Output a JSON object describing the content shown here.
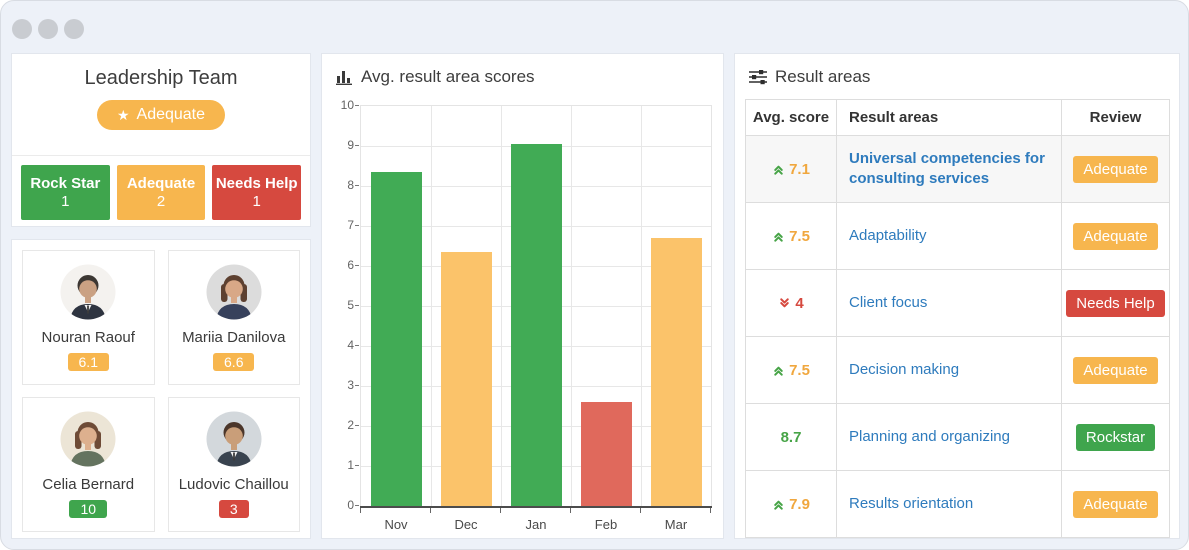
{
  "colors": {
    "green": "#3fa54d",
    "orange": "#f7b64e",
    "red": "#d6493f",
    "bar_green": "#41ab55",
    "bar_orange": "#fbc36a",
    "bar_red": "#e0695c",
    "score_orange": "#f0a73e",
    "score_green": "#47a447",
    "score_red": "#d6493f",
    "link_blue": "#2e7bbd"
  },
  "icons": {
    "chart_title_icon": "bar-chart-icon",
    "result_areas_title_icon": "sliders-icon",
    "overall_badge_icon": "star-icon"
  },
  "team": {
    "title": "Leadership Team",
    "overall_label": "Adequate",
    "overall_status": "orange",
    "stats": [
      {
        "label": "Rock Star",
        "count": "1",
        "status": "green"
      },
      {
        "label": "Adequate",
        "count": "2",
        "status": "orange"
      },
      {
        "label": "Needs Help",
        "count": "1",
        "status": "red"
      }
    ],
    "members": [
      {
        "name": "Nouran Raouf",
        "score": "6.1",
        "status": "orange"
      },
      {
        "name": "Mariia Danilova",
        "score": "6.6",
        "status": "orange"
      },
      {
        "name": "Celia Bernard",
        "score": "10",
        "status": "green"
      },
      {
        "name": "Ludovic Chaillou",
        "score": "3",
        "status": "red"
      }
    ]
  },
  "chart_data": {
    "type": "bar",
    "title": "Avg. result area scores",
    "categories": [
      "Nov",
      "Dec",
      "Jan",
      "Feb",
      "Mar"
    ],
    "values": [
      8.35,
      6.35,
      9.05,
      2.6,
      6.7
    ],
    "bar_status": [
      "green",
      "orange",
      "green",
      "red",
      "orange"
    ],
    "xlabel": "",
    "ylabel": "",
    "ylim": [
      0,
      10
    ],
    "ytick_step": 1,
    "grid": true,
    "legend": false
  },
  "result_areas": {
    "title": "Result areas",
    "columns": [
      "Avg. score",
      "Result areas",
      "Review"
    ],
    "rows": [
      {
        "score": "7.1",
        "trend": "up",
        "score_status": "orange",
        "area": "Universal competencies for consulting services",
        "bold": true,
        "review": "Adequate",
        "review_status": "orange",
        "shaded": true
      },
      {
        "score": "7.5",
        "trend": "up",
        "score_status": "orange",
        "area": "Adaptability",
        "bold": false,
        "review": "Adequate",
        "review_status": "orange",
        "shaded": false
      },
      {
        "score": "4",
        "trend": "down",
        "score_status": "red",
        "area": "Client focus",
        "bold": false,
        "review": "Needs Help",
        "review_status": "red",
        "shaded": false
      },
      {
        "score": "7.5",
        "trend": "up",
        "score_status": "orange",
        "area": "Decision making",
        "bold": false,
        "review": "Adequate",
        "review_status": "orange",
        "shaded": false
      },
      {
        "score": "8.7",
        "trend": "none",
        "score_status": "green",
        "area": "Planning and organizing",
        "bold": false,
        "review": "Rockstar",
        "review_status": "green",
        "shaded": false
      },
      {
        "score": "7.9",
        "trend": "up",
        "score_status": "orange",
        "area": "Results orientation",
        "bold": false,
        "review": "Adequate",
        "review_status": "orange",
        "shaded": false
      }
    ]
  }
}
